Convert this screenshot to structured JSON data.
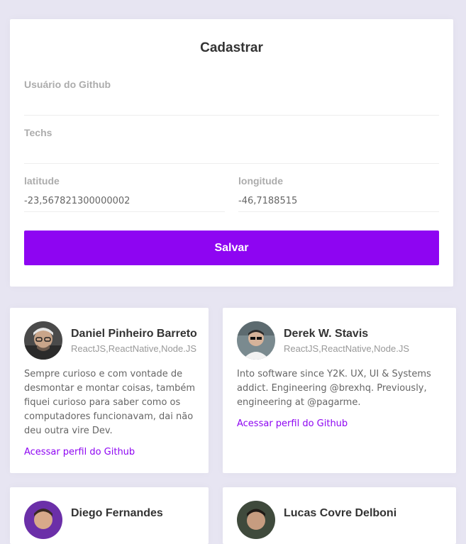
{
  "form": {
    "title": "Cadastrar",
    "github_user": {
      "label": "Usuário do Github",
      "value": ""
    },
    "techs": {
      "label": "Techs",
      "value": ""
    },
    "latitude": {
      "label": "latitude",
      "value": "-23,567821300000002"
    },
    "longitude": {
      "label": "longitude",
      "value": "-46,7188515"
    },
    "save_label": "Salvar"
  },
  "accent_color": "#8e05f2",
  "devs": [
    {
      "name": "Daniel Pinheiro Barreto",
      "techs": "ReactJS,ReactNative,Node.JS",
      "bio": "Sempre curioso e com vontade de desmontar e montar coisas, também fiquei curioso para saber como os computadores funcionavam, dai não deu outra vire Dev.",
      "link_label": "Acessar perfil do Github",
      "avatar": "avatar-photo"
    },
    {
      "name": "Derek W. Stavis",
      "techs": "ReactJS,ReactNative,Node.JS",
      "bio": "Into software since Y2K. UX, UI & Systems addict. Engineering @brexhq. Previously, engineering at @pagarme.",
      "link_label": "Acessar perfil do Github",
      "avatar": "avatar-photo"
    },
    {
      "name": "Diego Fernandes",
      "avatar": "avatar-photo"
    },
    {
      "name": "Lucas Covre Delboni",
      "avatar": "avatar-photo"
    }
  ]
}
